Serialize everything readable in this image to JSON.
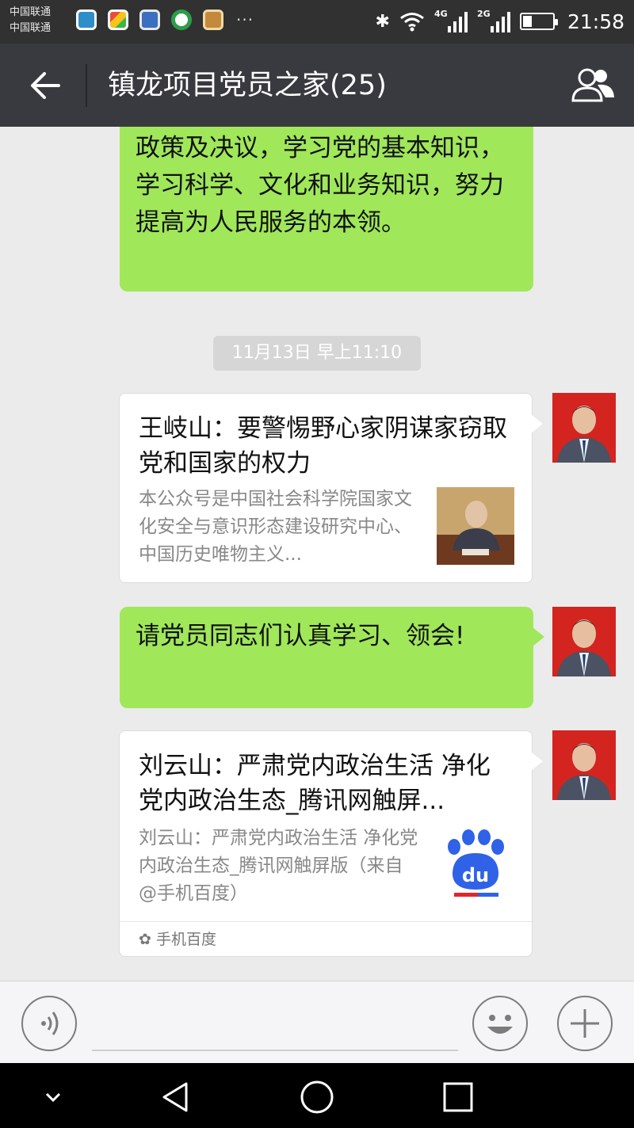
{
  "status_bar": {
    "carrier1": "中国联通",
    "carrier2": "中国联通",
    "more_indicator": "···",
    "network1": "4G",
    "network2": "2G",
    "battery_level": 0.3,
    "time": "21:58"
  },
  "title_bar": {
    "title": "镇龙项目党员之家(25)"
  },
  "messages": {
    "msg1": {
      "text": "政策及决议，学习党的基本知识，学习科学、文化和业务知识，努力提高为人民服务的本领。"
    },
    "timestamp": "11月13日 早上11:10",
    "card1": {
      "title": "王岐山：要警惕野心家阴谋家窃取党和国家的权力",
      "desc": "本公众号是中国社会科学院国家文化安全与意识形态建设研究中心、中国历史唯物主义..."
    },
    "msg2": {
      "text": "请党员同志们认真学习、领会!"
    },
    "card2": {
      "title": "刘云山：严肃党内政治生活 净化党内政治生态_腾讯网触屏...",
      "desc": "刘云山：严肃党内政治生活 净化党内政治生态_腾讯网触屏版（来自@手机百度）",
      "source": "手机百度",
      "thumb_text": "du"
    }
  },
  "colors": {
    "status_bar": "#313131",
    "title_bar": "#393a3f",
    "chat_bg": "#ebebeb",
    "bubble_green": "#a0e75a",
    "baidu_blue": "#2f62e7",
    "baidu_red": "#e1262c"
  },
  "icons": {
    "back": "arrow-left-icon",
    "members": "group-icon",
    "voice": "voice-icon",
    "emoji": "smiley-icon",
    "plus": "plus-icon",
    "nav_hide": "chevron-down-icon",
    "nav_back": "triangle-back-icon",
    "nav_home": "circle-home-icon",
    "nav_recent": "square-recent-icon"
  }
}
